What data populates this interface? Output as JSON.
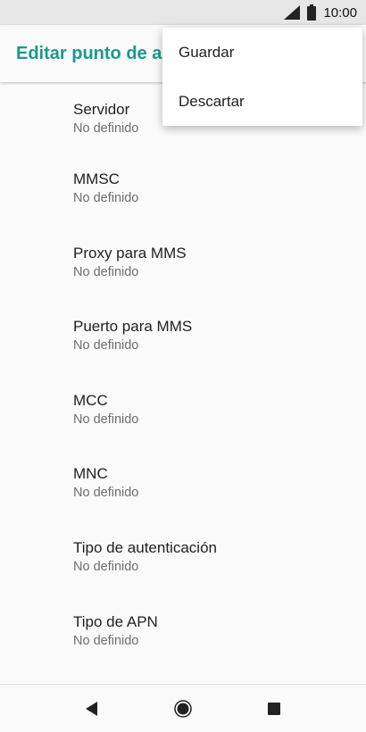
{
  "status_bar": {
    "time": "10:00",
    "icons": [
      "signal-icon",
      "battery-icon"
    ]
  },
  "app_bar": {
    "title": "Editar punto de acceso"
  },
  "overflow_menu": {
    "items": [
      {
        "label": "Guardar"
      },
      {
        "label": "Descartar"
      }
    ]
  },
  "settings": {
    "items": [
      {
        "title": "Servidor",
        "value": "No definido"
      },
      {
        "title": "MMSC",
        "value": "No definido"
      },
      {
        "title": "Proxy para MMS",
        "value": "No definido"
      },
      {
        "title": "Puerto para MMS",
        "value": "No definido"
      },
      {
        "title": "MCC",
        "value": "No definido"
      },
      {
        "title": "MNC",
        "value": "No definido"
      },
      {
        "title": "Tipo de autenticación",
        "value": "No definido"
      },
      {
        "title": "Tipo de APN",
        "value": "No definido"
      }
    ]
  },
  "nav_bar": {
    "icons": [
      "back-icon",
      "home-icon",
      "recents-icon"
    ]
  },
  "colors": {
    "accent": "#1a9a8a",
    "status_bar": "#e6e6e6",
    "background": "#fafafa"
  }
}
